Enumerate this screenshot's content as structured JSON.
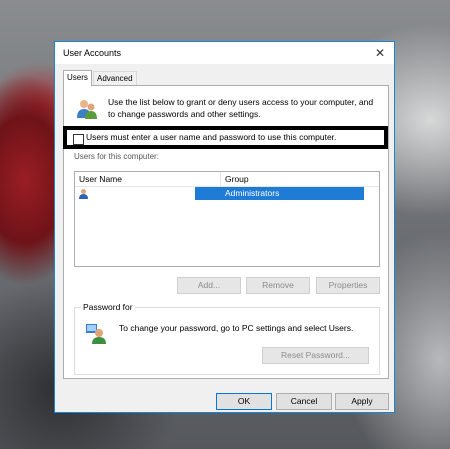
{
  "window": {
    "title": "User Accounts",
    "close_glyph": "✕"
  },
  "tabs": [
    {
      "label": "Users",
      "active": true
    },
    {
      "label": "Advanced",
      "active": false
    }
  ],
  "description": "Use the list below to grant or deny users access to your computer, and to change passwords and other settings.",
  "checkbox": {
    "label": "Users must enter a user name and password to use this computer.",
    "checked": false
  },
  "users_list": {
    "label": "Users for this computer:",
    "columns": [
      "User Name",
      "Group"
    ],
    "rows": [
      {
        "user_name": "",
        "group": "Administrators",
        "selected": true
      }
    ]
  },
  "list_buttons": {
    "add": "Add...",
    "remove": "Remove",
    "properties": "Properties"
  },
  "password_group": {
    "title": "Password for",
    "text": "To change your password, go to PC settings and select Users.",
    "reset_button": "Reset Password..."
  },
  "dialog_buttons": {
    "ok": "OK",
    "cancel": "Cancel",
    "apply": "Apply"
  },
  "colors": {
    "accent": "#0078d7",
    "selection": "#1e7cd6",
    "highlight_border": "#000000"
  },
  "icons": {
    "users": "users-icon",
    "user_row": "user-icon",
    "password": "password-user-icon"
  }
}
